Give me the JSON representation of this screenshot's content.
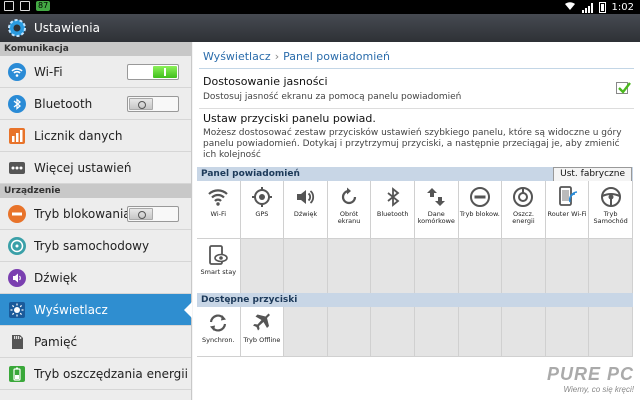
{
  "statusbar": {
    "badge": "87",
    "time": "1:02"
  },
  "app": {
    "title": "Ustawienia"
  },
  "sidebar": {
    "sections": [
      {
        "title": "Komunikacja"
      },
      {
        "title": "Urządzenie"
      }
    ],
    "items": [
      {
        "label": "Wi-Fi",
        "icon": "wifi-icon",
        "toggle": "on"
      },
      {
        "label": "Bluetooth",
        "icon": "bluetooth-icon",
        "toggle": "off"
      },
      {
        "label": "Licznik danych",
        "icon": "data-usage-icon"
      },
      {
        "label": "Więcej ustawień",
        "icon": "more-dots-icon"
      },
      {
        "label": "Tryb blokowania",
        "icon": "blocking-mode-icon",
        "toggle": "off"
      },
      {
        "label": "Tryb samochodowy",
        "icon": "driving-mode-icon"
      },
      {
        "label": "Dźwięk",
        "icon": "sound-icon"
      },
      {
        "label": "Wyświetlacz",
        "icon": "display-icon",
        "active": true
      },
      {
        "label": "Pamięć",
        "icon": "storage-icon"
      },
      {
        "label": "Tryb oszczędzania energii",
        "icon": "power-saving-icon"
      }
    ]
  },
  "main": {
    "breadcrumb": [
      "Wyświetlacz",
      "Panel powiadomień"
    ],
    "brightness": {
      "title": "Dostosowanie jasności",
      "subtitle": "Dostosuj jasność ekranu za pomocą panelu powiadomień",
      "checked": true
    },
    "buttons_setting": {
      "title": "Ustaw przyciski panelu powiad.",
      "subtitle": "Możesz dostosować zestaw przycisków ustawień szybkiego panelu, które są widoczne u góry panelu powiadomień. Dotykaj i przytrzymuj przyciski, a następnie przeciągaj je, aby zmienić ich kolejność"
    },
    "panel_header": "Panel powiadomień",
    "reset_label": "Ust. fabryczne",
    "active_buttons": [
      {
        "label": "Wi-Fi",
        "icon": "wifi-icon"
      },
      {
        "label": "GPS",
        "icon": "gps-icon"
      },
      {
        "label": "Dźwięk",
        "icon": "sound-icon"
      },
      {
        "label": "Obrót ekranu",
        "icon": "rotate-icon"
      },
      {
        "label": "Bluetooth",
        "icon": "bluetooth-icon"
      },
      {
        "label": "Dane komórkowe",
        "icon": "mobile-data-icon"
      },
      {
        "label": "Tryb blokow.",
        "icon": "blocking-mode-icon"
      },
      {
        "label": "Oszcz. energii",
        "icon": "power-saving-icon"
      },
      {
        "label": "Router Wi-Fi",
        "icon": "hotspot-icon"
      },
      {
        "label": "Tryb Samochód",
        "icon": "driving-mode-icon"
      },
      {
        "label": "Smart stay",
        "icon": "smart-stay-icon"
      }
    ],
    "available_header": "Dostępne przyciski",
    "available_buttons": [
      {
        "label": "Synchron.",
        "icon": "sync-icon"
      },
      {
        "label": "Tryb Offline",
        "icon": "airplane-icon"
      }
    ]
  },
  "watermark": {
    "brand": "PURE PC",
    "tagline": "Wiemy, co się kręci!"
  }
}
